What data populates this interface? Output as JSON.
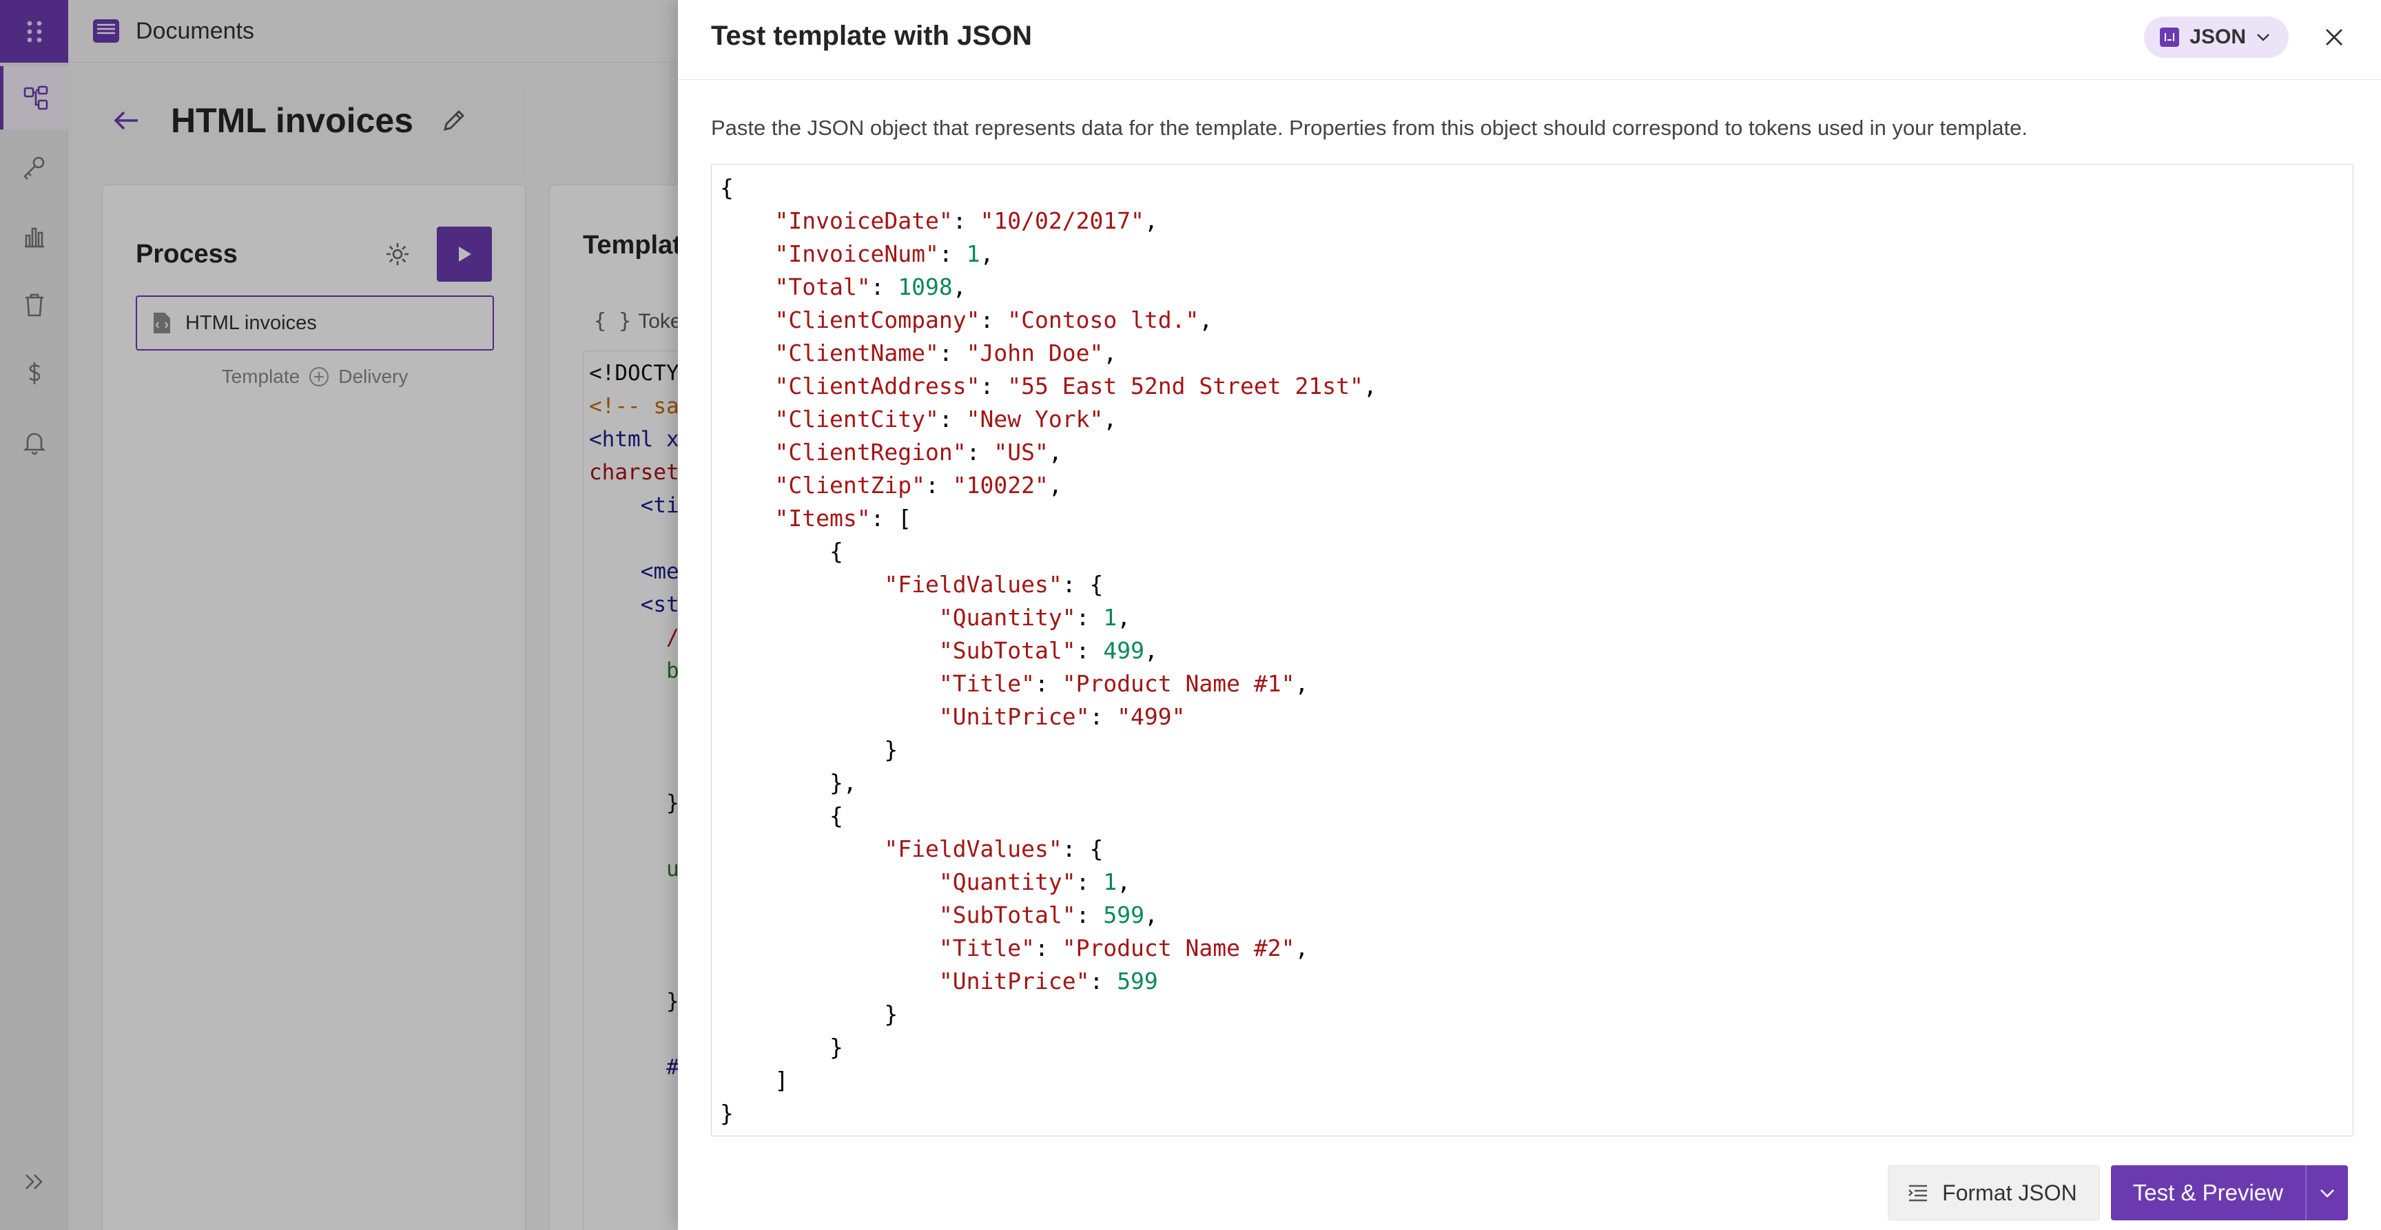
{
  "app": {
    "title": "Documents"
  },
  "page": {
    "title": "HTML invoices"
  },
  "process": {
    "title": "Process",
    "document": "HTML invoices",
    "flow_left": "Template",
    "flow_right": "Delivery"
  },
  "template_card": {
    "title": "Template",
    "tokens_label": "Tokens",
    "code_lines": [
      {
        "cls": "c-blk",
        "text": "<!DOCTYPE html>"
      },
      {
        "cls": "c-cmt",
        "text": "<!-- saved from url"
      },
      {
        "cls": "c-tag",
        "text": "<html xmlns"
      },
      {
        "cls": "c-red",
        "text": "charset"
      },
      {
        "cls": "c-tag",
        "text": "    <title>"
      },
      {
        "cls": "c-blk",
        "text": ""
      },
      {
        "cls": "c-tag",
        "text": "    <meta"
      },
      {
        "cls": "c-tag",
        "text": "    <style"
      },
      {
        "cls": "c-red",
        "text": "      /*"
      },
      {
        "cls": "c-green",
        "text": "      body"
      },
      {
        "cls": "c-blk",
        "text": ""
      },
      {
        "cls": "c-blk",
        "text": ""
      },
      {
        "cls": "c-blk",
        "text": ""
      },
      {
        "cls": "c-blk",
        "text": "      }"
      },
      {
        "cls": "c-blk",
        "text": ""
      },
      {
        "cls": "c-green",
        "text": "      ul"
      },
      {
        "cls": "c-blk",
        "text": ""
      },
      {
        "cls": "c-blk",
        "text": ""
      },
      {
        "cls": "c-blk",
        "text": ""
      },
      {
        "cls": "c-blk",
        "text": "      }"
      },
      {
        "cls": "c-blk",
        "text": ""
      },
      {
        "cls": "c-tag",
        "text": "      #"
      }
    ]
  },
  "panel": {
    "title": "Test template with JSON",
    "format_badge": "JSON",
    "description": "Paste the JSON object that represents data for the template. Properties from this object should correspond to tokens used in your template.",
    "json_lines": [
      [
        {
          "t": "p",
          "v": "{"
        }
      ],
      [
        {
          "t": "p",
          "v": "    "
        },
        {
          "t": "k",
          "v": "\"InvoiceDate\""
        },
        {
          "t": "p",
          "v": ": "
        },
        {
          "t": "s",
          "v": "\"10/02/2017\""
        },
        {
          "t": "p",
          "v": ","
        }
      ],
      [
        {
          "t": "p",
          "v": "    "
        },
        {
          "t": "k",
          "v": "\"InvoiceNum\""
        },
        {
          "t": "p",
          "v": ": "
        },
        {
          "t": "n",
          "v": "1"
        },
        {
          "t": "p",
          "v": ","
        }
      ],
      [
        {
          "t": "p",
          "v": "    "
        },
        {
          "t": "k",
          "v": "\"Total\""
        },
        {
          "t": "p",
          "v": ": "
        },
        {
          "t": "n",
          "v": "1098"
        },
        {
          "t": "p",
          "v": ","
        }
      ],
      [
        {
          "t": "p",
          "v": "    "
        },
        {
          "t": "k",
          "v": "\"ClientCompany\""
        },
        {
          "t": "p",
          "v": ": "
        },
        {
          "t": "s",
          "v": "\"Contoso ltd.\""
        },
        {
          "t": "p",
          "v": ","
        }
      ],
      [
        {
          "t": "p",
          "v": "    "
        },
        {
          "t": "k",
          "v": "\"ClientName\""
        },
        {
          "t": "p",
          "v": ": "
        },
        {
          "t": "s",
          "v": "\"John Doe\""
        },
        {
          "t": "p",
          "v": ","
        }
      ],
      [
        {
          "t": "p",
          "v": "    "
        },
        {
          "t": "k",
          "v": "\"ClientAddress\""
        },
        {
          "t": "p",
          "v": ": "
        },
        {
          "t": "s",
          "v": "\"55 East 52nd Street 21st\""
        },
        {
          "t": "p",
          "v": ","
        }
      ],
      [
        {
          "t": "p",
          "v": "    "
        },
        {
          "t": "k",
          "v": "\"ClientCity\""
        },
        {
          "t": "p",
          "v": ": "
        },
        {
          "t": "s",
          "v": "\"New York\""
        },
        {
          "t": "p",
          "v": ","
        }
      ],
      [
        {
          "t": "p",
          "v": "    "
        },
        {
          "t": "k",
          "v": "\"ClientRegion\""
        },
        {
          "t": "p",
          "v": ": "
        },
        {
          "t": "s",
          "v": "\"US\""
        },
        {
          "t": "p",
          "v": ","
        }
      ],
      [
        {
          "t": "p",
          "v": "    "
        },
        {
          "t": "k",
          "v": "\"ClientZip\""
        },
        {
          "t": "p",
          "v": ": "
        },
        {
          "t": "s",
          "v": "\"10022\""
        },
        {
          "t": "p",
          "v": ","
        }
      ],
      [
        {
          "t": "p",
          "v": "    "
        },
        {
          "t": "k",
          "v": "\"Items\""
        },
        {
          "t": "p",
          "v": ": ["
        }
      ],
      [
        {
          "t": "p",
          "v": "        {"
        }
      ],
      [
        {
          "t": "p",
          "v": "            "
        },
        {
          "t": "k",
          "v": "\"FieldValues\""
        },
        {
          "t": "p",
          "v": ": {"
        }
      ],
      [
        {
          "t": "p",
          "v": "                "
        },
        {
          "t": "k",
          "v": "\"Quantity\""
        },
        {
          "t": "p",
          "v": ": "
        },
        {
          "t": "n",
          "v": "1"
        },
        {
          "t": "p",
          "v": ","
        }
      ],
      [
        {
          "t": "p",
          "v": "                "
        },
        {
          "t": "k",
          "v": "\"SubTotal\""
        },
        {
          "t": "p",
          "v": ": "
        },
        {
          "t": "n",
          "v": "499"
        },
        {
          "t": "p",
          "v": ","
        }
      ],
      [
        {
          "t": "p",
          "v": "                "
        },
        {
          "t": "k",
          "v": "\"Title\""
        },
        {
          "t": "p",
          "v": ": "
        },
        {
          "t": "s",
          "v": "\"Product Name #1\""
        },
        {
          "t": "p",
          "v": ","
        }
      ],
      [
        {
          "t": "p",
          "v": "                "
        },
        {
          "t": "k",
          "v": "\"UnitPrice\""
        },
        {
          "t": "p",
          "v": ": "
        },
        {
          "t": "s",
          "v": "\"499\""
        }
      ],
      [
        {
          "t": "p",
          "v": "            }"
        }
      ],
      [
        {
          "t": "p",
          "v": "        },"
        }
      ],
      [
        {
          "t": "p",
          "v": "        {"
        }
      ],
      [
        {
          "t": "p",
          "v": "            "
        },
        {
          "t": "k",
          "v": "\"FieldValues\""
        },
        {
          "t": "p",
          "v": ": {"
        }
      ],
      [
        {
          "t": "p",
          "v": "                "
        },
        {
          "t": "k",
          "v": "\"Quantity\""
        },
        {
          "t": "p",
          "v": ": "
        },
        {
          "t": "n",
          "v": "1"
        },
        {
          "t": "p",
          "v": ","
        }
      ],
      [
        {
          "t": "p",
          "v": "                "
        },
        {
          "t": "k",
          "v": "\"SubTotal\""
        },
        {
          "t": "p",
          "v": ": "
        },
        {
          "t": "n",
          "v": "599"
        },
        {
          "t": "p",
          "v": ","
        }
      ],
      [
        {
          "t": "p",
          "v": "                "
        },
        {
          "t": "k",
          "v": "\"Title\""
        },
        {
          "t": "p",
          "v": ": "
        },
        {
          "t": "s",
          "v": "\"Product Name #2\""
        },
        {
          "t": "p",
          "v": ","
        }
      ],
      [
        {
          "t": "p",
          "v": "                "
        },
        {
          "t": "k",
          "v": "\"UnitPrice\""
        },
        {
          "t": "p",
          "v": ": "
        },
        {
          "t": "n",
          "v": "599"
        }
      ],
      [
        {
          "t": "p",
          "v": "            }"
        }
      ],
      [
        {
          "t": "p",
          "v": "        }"
        }
      ],
      [
        {
          "t": "p",
          "v": "    ]"
        }
      ],
      [
        {
          "t": "p",
          "v": "}"
        }
      ]
    ],
    "format_button": "Format JSON",
    "primary_button": "Test & Preview"
  },
  "colors": {
    "accent": "#6b3ab0",
    "json_key": "#a31515",
    "json_number": "#09885a"
  },
  "icons": {
    "rail": [
      "apps-grid-icon",
      "process-icon",
      "key-icon",
      "bar-chart-icon",
      "trash-icon",
      "dollar-icon",
      "bell-icon",
      "expand-icon"
    ]
  }
}
